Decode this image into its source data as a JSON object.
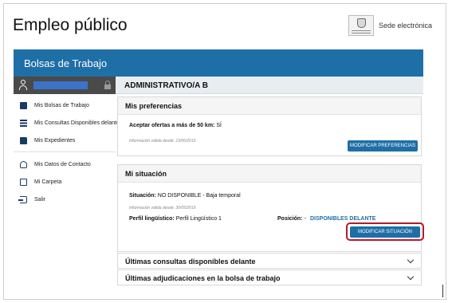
{
  "header": {
    "title": "Empleo público",
    "sede_label": "Sede electrónica"
  },
  "banner": {
    "title": "Bolsas de Trabajo"
  },
  "sidebar": {
    "items": [
      {
        "label": "Mis Bolsas de Trabajo",
        "icon": "briefcase-icon"
      },
      {
        "label": "Mis Consultas Disponibles delante",
        "icon": "list-icon"
      },
      {
        "label": "Mis Expedientes",
        "icon": "folder-icon"
      },
      {
        "label": "Mis Datos de Contacto",
        "icon": "user-icon"
      },
      {
        "label": "Mi Carpeta",
        "icon": "folder-outline-icon"
      },
      {
        "label": "Salir",
        "icon": "exit-icon"
      }
    ]
  },
  "main": {
    "section_title": "ADMINISTRATIVO/A B",
    "preferences": {
      "title": "Mis preferencias",
      "offer_label": "Aceptar ofertas a más de 50 km:",
      "offer_value": "SÍ",
      "info": "Información válida desde: 13/06/2019",
      "button": "MODIFICAR PREFERENCIAS"
    },
    "situation": {
      "title": "Mi situación",
      "situation_label": "Situación:",
      "situation_value": "NO DISPONIBLE - Baja temporal",
      "info": "Información válida desde: 30/05/2019",
      "profile_label": "Perfil lingüístico:",
      "profile_value": "Perfil Lingüístico 1",
      "position_label": "Posición:",
      "position_value": "-",
      "available_link": "DISPONIBLES DELANTE",
      "button": "MODIFICAR SITUACIÓN"
    },
    "accordions": [
      {
        "label": "Últimas consultas disponibles delante"
      },
      {
        "label": "Últimas adjudicaciones en la bolsa de trabajo"
      }
    ]
  },
  "colors": {
    "brand_blue": "#1f6fa7",
    "highlight_red": "#b21a2a",
    "user_bar": "#4a4a4a"
  }
}
